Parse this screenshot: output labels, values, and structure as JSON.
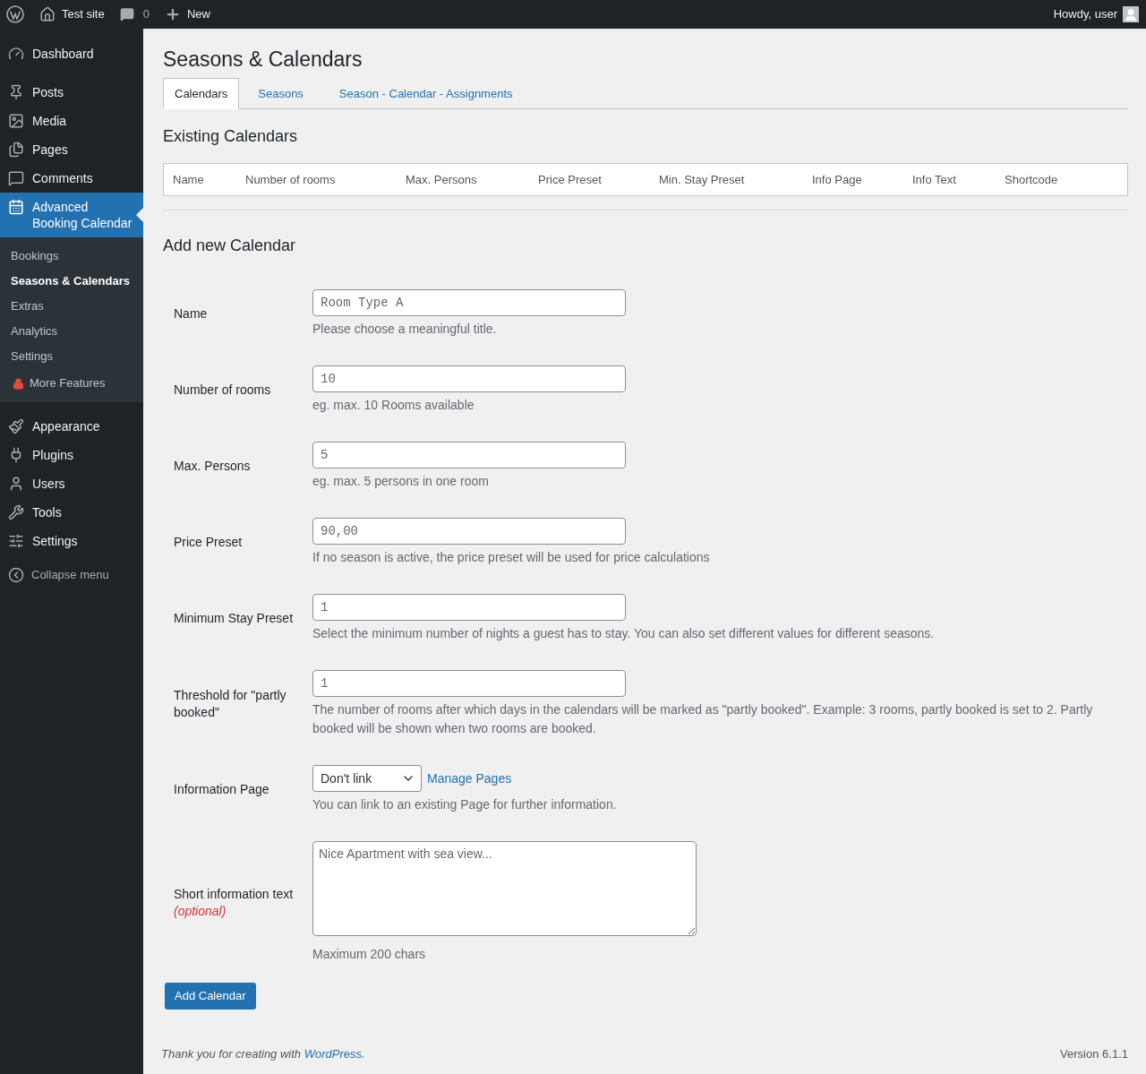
{
  "admin_bar": {
    "site": "Test site",
    "comments": "0",
    "new": "New",
    "greeting": "Howdy, user"
  },
  "sidebar": {
    "items": [
      {
        "label": "Dashboard",
        "selected": false
      },
      {
        "label": "Posts",
        "selected": false
      },
      {
        "label": "Media",
        "selected": false
      },
      {
        "label": "Pages",
        "selected": false
      },
      {
        "label": "Comments",
        "selected": false
      },
      {
        "label": "Advanced Booking Calendar",
        "selected": true,
        "children": [
          {
            "label": "Bookings",
            "selected": false,
            "kind": "link"
          },
          {
            "label": "Seasons & Calendars",
            "selected": true,
            "kind": "link"
          },
          {
            "label": "Extras",
            "selected": false,
            "kind": "link"
          },
          {
            "label": "Analytics",
            "selected": false,
            "kind": "link"
          },
          {
            "label": "Settings",
            "selected": false,
            "kind": "link"
          },
          {
            "label": "More Features",
            "selected": false,
            "kind": "locked"
          }
        ]
      },
      {
        "label": "Appearance",
        "selected": false
      },
      {
        "label": "Plugins",
        "selected": false
      },
      {
        "label": "Users",
        "selected": false
      },
      {
        "label": "Tools",
        "selected": false
      },
      {
        "label": "Settings",
        "selected": false
      }
    ],
    "collapse": "Collapse menu"
  },
  "page": {
    "title": "Seasons & Calendars",
    "tabs": [
      {
        "label": "Calendars",
        "selected": true
      },
      {
        "label": "Seasons",
        "selected": false
      },
      {
        "label": "Season - Calendar - Assignments",
        "selected": false
      }
    ],
    "existing_title": "Existing Calendars",
    "table": {
      "columns": [
        "Name",
        "Number of rooms",
        "Max. Persons",
        "Price Preset",
        "Min. Stay Preset",
        "Info Page",
        "Info Text",
        "Shortcode"
      ]
    },
    "form_title": "Add new Calendar",
    "form": [
      {
        "kind": "text",
        "label": "Name",
        "placeholder": "Room Type A",
        "help": "Please choose a meaningful title."
      },
      {
        "kind": "text",
        "label": "Number of rooms",
        "placeholder": "10",
        "help": "eg. max. 10 Rooms available"
      },
      {
        "kind": "text",
        "label": "Max. Persons",
        "placeholder": "5",
        "help": "eg. max. 5 persons in one room"
      },
      {
        "kind": "text",
        "label": "Price Preset",
        "placeholder": "90,00",
        "help": "If no season is active, the price preset will be used for price calculations"
      },
      {
        "kind": "text",
        "label": "Minimum Stay Preset",
        "placeholder": "1",
        "help": "Select the minimum number of nights a guest has to stay. You can also set different values for different seasons."
      },
      {
        "kind": "text",
        "label": "Threshold for \"partly booked\"",
        "placeholder": "1",
        "help": "The number of rooms after which days in the calendars will be marked as \"partly booked\". Example: 3 rooms, partly booked is set to 2. Partly booked will be shown when two rooms are booked."
      },
      {
        "kind": "select",
        "label": "Information Page",
        "value": "Don't link",
        "link": "Manage Pages",
        "help": "You can link to an existing Page for further information."
      },
      {
        "kind": "textarea",
        "label": "Short information text",
        "note": "(optional)",
        "placeholder": "Nice Apartment with sea view...",
        "help": "Maximum 200 chars"
      }
    ],
    "submit": "Add Calendar"
  },
  "footer": {
    "thanks": "Thank you for creating with",
    "link": "WordPress",
    "after": ".",
    "version": "Version 6.1.1"
  }
}
